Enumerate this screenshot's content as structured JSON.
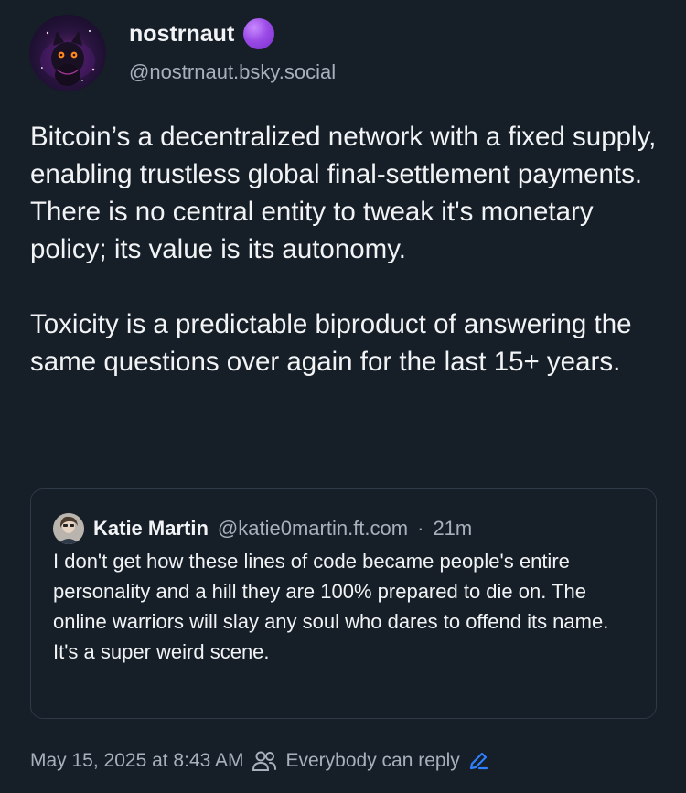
{
  "post": {
    "author": {
      "name": "nostrnaut",
      "handle": "@nostrnaut.bsky.social",
      "avatar_icon": "space-cat-avatar",
      "badge_color": "#9b4be6"
    },
    "paragraphs": [
      "Bitcoin’s a decentralized network with a fixed supply, enabling trustless global final-settlement payments. There is no central entity to tweak it's monetary policy; its value is its autonomy.",
      "Toxicity is a predictable biproduct of answering the same questions over again for the last 15+ years."
    ],
    "quote": {
      "author_name": "Katie Martin",
      "author_handle": "@katie0martin.ft.com",
      "separator": "·",
      "time": "21m",
      "lines": [
        "I don't get how these lines of code became people's entire personality and a hill they are 100% prepared to die on. The online warriors will slay any soul who dares to offend its name.",
        "It's a super weird scene."
      ]
    },
    "footer": {
      "timestamp": "May 15, 2025 at 8:43 AM",
      "reply_setting": "Everybody can reply",
      "icons": [
        "people-icon",
        "pencil-icon"
      ]
    }
  },
  "colors": {
    "background": "#161e27",
    "text_primary": "#f1f3f5",
    "text_secondary": "#a7b0bd",
    "accent": "#2f80ff",
    "card_border": "#2e3a47"
  }
}
